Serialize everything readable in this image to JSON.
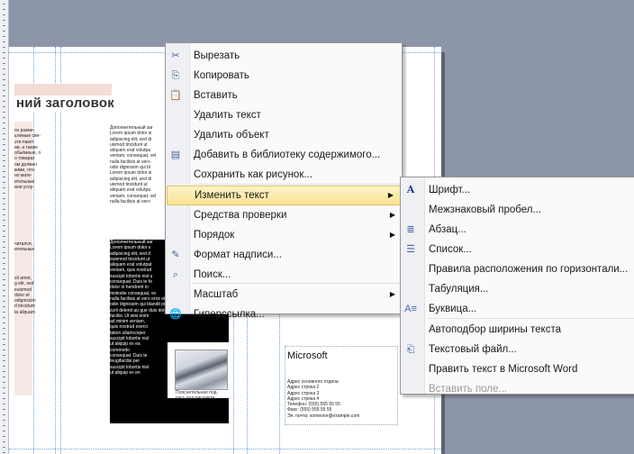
{
  "document": {
    "heading": "ний заголовок",
    "col_mid_text": "Дополнительный заг\nLorem ipsum dolor si\nadipiscing elit, sed di\nuismod tincidunt ut\naliquam erat volutpa\nveniam, consequat, vel\nnulla facilisis at vero\nodio dignissim qui bl\nLorem ipsum dolor si\nadipiscing elit, sed di\nuismod tincidunt ut\naliquam erat volutpa\nveniam, consequat, vel\nnulla facilisis at vero",
    "col_left_text": "ях разме-\nьлемые све-\nэти пакет\nии, а также\nобьёмные, о\nо товарах\nом должен\nкими, что-\nно мате-\nительные\nили услу-",
    "col_left_text2": "читался,\nительные",
    "col_left_text3": "sit amet,\ng elit, sed\neuismod\ndolor et\nodignissim\nd tincidunt\nta aliquam",
    "col_mid_inv_text": "Дополнительный заг\nLorem ipsum dolor s\nadipiscing elit, sed d\neuismod tincidunt ut\naliquam erat volutpat\nveniam, quis nostrud\nsuscipit lobortis nisl u\nconsequat. Duis te fe\ndolor in hendrerit in\nmolestie consequat, ve\nnulla facilisis at vero eros et accumsan et iusto\nodio dignissim qui blandit praesent luptatum\nzzril delenit au gue duis dolore te feugait nulla\nfacilisi. Ut wisi enim\nad minim veniam,\nquis nostrud exerci\ntation ullamcorper\nsuscipit lobortis nisl\nut aliquip ex ea\ncommodo\nconsequat. Duis te\nfeugifacilisi per\nsuscipit lobortis nisl\nut aliquip ex en",
    "photo_caption": "Пояснительная под-\nпись под рисунком.",
    "ms_title": "Microsoft",
    "ms_lines": [
      "Адрес основного отдела",
      "Адрес строка 2",
      "Адрес строка 3",
      "Адрес строка 4",
      "Телефон: (555) 555 55 55",
      "Факс: (555) 555 55 55",
      "Эл. почта: someone@example.com"
    ]
  },
  "context_menu": {
    "items": [
      {
        "icon": "scissors-icon",
        "glyph": "✂",
        "label": "Вырезать",
        "key": "cut"
      },
      {
        "icon": "copy-icon",
        "glyph": "⎘",
        "label": "Копировать",
        "key": "copy"
      },
      {
        "icon": "paste-icon",
        "glyph": "📋",
        "label": "Вставить",
        "key": "paste"
      },
      {
        "icon": "",
        "glyph": "",
        "label": "Удалить текст",
        "key": "delete-text"
      },
      {
        "icon": "",
        "glyph": "",
        "label": "Удалить объект",
        "key": "delete-object"
      },
      {
        "icon": "library-icon",
        "glyph": "▤",
        "label": "Добавить в библиотеку содержимого...",
        "key": "add-library"
      },
      {
        "icon": "",
        "glyph": "",
        "label": "Сохранить как рисунок...",
        "key": "save-picture"
      },
      {
        "icon": "",
        "glyph": "",
        "label": "Изменить текст",
        "key": "edit-text",
        "submenu": true,
        "highlighted": true
      },
      {
        "icon": "",
        "glyph": "",
        "label": "Средства проверки",
        "key": "proofing",
        "submenu": true
      },
      {
        "icon": "",
        "glyph": "",
        "label": "Порядок",
        "key": "order",
        "submenu": true
      },
      {
        "icon": "format-icon",
        "glyph": "✎",
        "label": "Формат надписи...",
        "key": "format-box"
      },
      {
        "icon": "search-icon",
        "glyph": "⌕",
        "label": "Поиск...",
        "key": "search"
      },
      {
        "icon": "",
        "glyph": "",
        "label": "Масштаб",
        "key": "zoom",
        "submenu": true
      },
      {
        "icon": "hyperlink-icon",
        "glyph": "🌐",
        "label": "Гиперссылка...",
        "key": "hyperlink"
      }
    ]
  },
  "submenu": {
    "items": [
      {
        "icon": "font-icon",
        "glyph": "A",
        "label": "Шрифт...",
        "key": "font"
      },
      {
        "icon": "",
        "glyph": "",
        "label": "Межзнаковый пробел...",
        "key": "spacing"
      },
      {
        "icon": "paragraph-icon",
        "glyph": "≣",
        "label": "Абзац...",
        "key": "paragraph"
      },
      {
        "icon": "list-icon",
        "glyph": "☰",
        "label": "Список...",
        "key": "list"
      },
      {
        "icon": "",
        "glyph": "",
        "label": "Правила расположения по горизонтали...",
        "key": "hrules"
      },
      {
        "icon": "",
        "glyph": "",
        "label": "Табуляция...",
        "key": "tabs"
      },
      {
        "icon": "dropcap-icon",
        "glyph": "A≡",
        "label": "Буквица...",
        "key": "dropcap"
      },
      {
        "icon": "",
        "glyph": "",
        "label": "Автоподбор ширины текста",
        "key": "autofit"
      },
      {
        "icon": "textfile-icon",
        "glyph": "⎗",
        "label": "Текстовый файл...",
        "key": "textfile"
      },
      {
        "icon": "",
        "glyph": "",
        "label": "Править текст в Microsoft Word",
        "key": "edit-word"
      },
      {
        "icon": "",
        "glyph": "",
        "label": "Вставить поле...",
        "key": "insert-field",
        "disabled": true
      }
    ]
  },
  "colors": {
    "workspace": "#8d95a8",
    "menu_highlight": "#fbe394",
    "guide": "#6fa3d8"
  }
}
